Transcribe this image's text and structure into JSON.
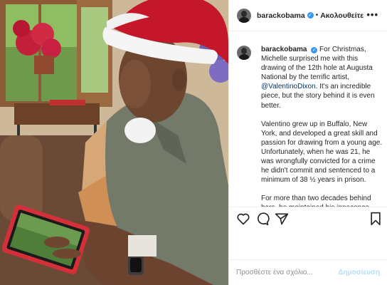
{
  "header": {
    "username": "barackobama",
    "separator": "•",
    "follow_label": "Ακολουθείτε",
    "more_label": "•••"
  },
  "caption": {
    "username": "barackobama",
    "p1_before": "For Christmas, Michelle surprised me with this drawing of the 12th hole at Augusta National by the terrific artist, ",
    "mention": "@ValentinoDixon",
    "p1_after": ". It's an incredible piece, but the story behind it is even better.",
    "p2": "Valentino grew up in Buffalo, New York, and developed a great skill and passion for drawing from a young age. Unfortunately, when he was 21, he was wrongfully convicted for a crime he didn't commit and sentenced to a minimum of 38 ½ years in prison.",
    "p3": "For more than two decades behind bars, he maintained his innocence. Eventually, he renewed his passion for"
  },
  "actions": {
    "like_icon": "heart-icon",
    "comment_icon": "comment-icon",
    "share_icon": "paper-plane-icon",
    "save_icon": "bookmark-icon"
  },
  "comment_box": {
    "placeholder": "Προσθέστε ένα σχόλιο...",
    "publish_label": "Δημοσίευση"
  },
  "colors": {
    "verified": "#3897f0",
    "mention": "#00376b",
    "publish_disabled": "#b2dffc"
  }
}
